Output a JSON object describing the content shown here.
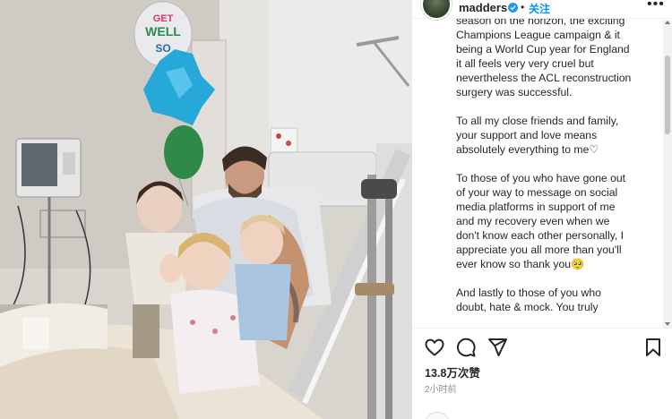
{
  "post": {
    "username": "madders",
    "follow_label": "关注",
    "separator": "•",
    "more_label": "•••",
    "caption_lines": {
      "l0": "season on the horizon, the exciting",
      "l1": "Champions League campaign & it",
      "l2": "being a World Cup year for England",
      "l3": "it all feels very very cruel but",
      "l4": "nevertheless the ACL reconstruction",
      "l5": "surgery was successful.",
      "l6": "To all my close friends and family,",
      "l7": "your support and love means",
      "l8": "absolutely everything to me♡",
      "l9": "To those of you who have gone out",
      "l10": "of your way to message on social",
      "l11": "media platforms in support of me",
      "l12": "and my recovery even when we",
      "l13": "don't know each other personally, I",
      "l14": "appreciate you all more than you'll",
      "l15": "ever know so thank you🥺",
      "l16": "And lastly to those of you who",
      "l17": "doubt, hate & mock. You truly"
    },
    "likes": "13.8万次赞",
    "time_ago": "2小时前"
  },
  "photo": {
    "balloon_text_line1": "GET",
    "balloon_text_line2": "WELL",
    "balloon_text_line3": "SO"
  },
  "icons": {
    "like": "heart-icon",
    "comment": "comment-icon",
    "share": "paper-plane-icon",
    "save": "bookmark-icon",
    "verified": "verified-badge-icon"
  },
  "colors": {
    "accent": "#0095f6",
    "verified": "#1d9bf0",
    "text": "#262626",
    "muted": "#8e8e8e"
  }
}
